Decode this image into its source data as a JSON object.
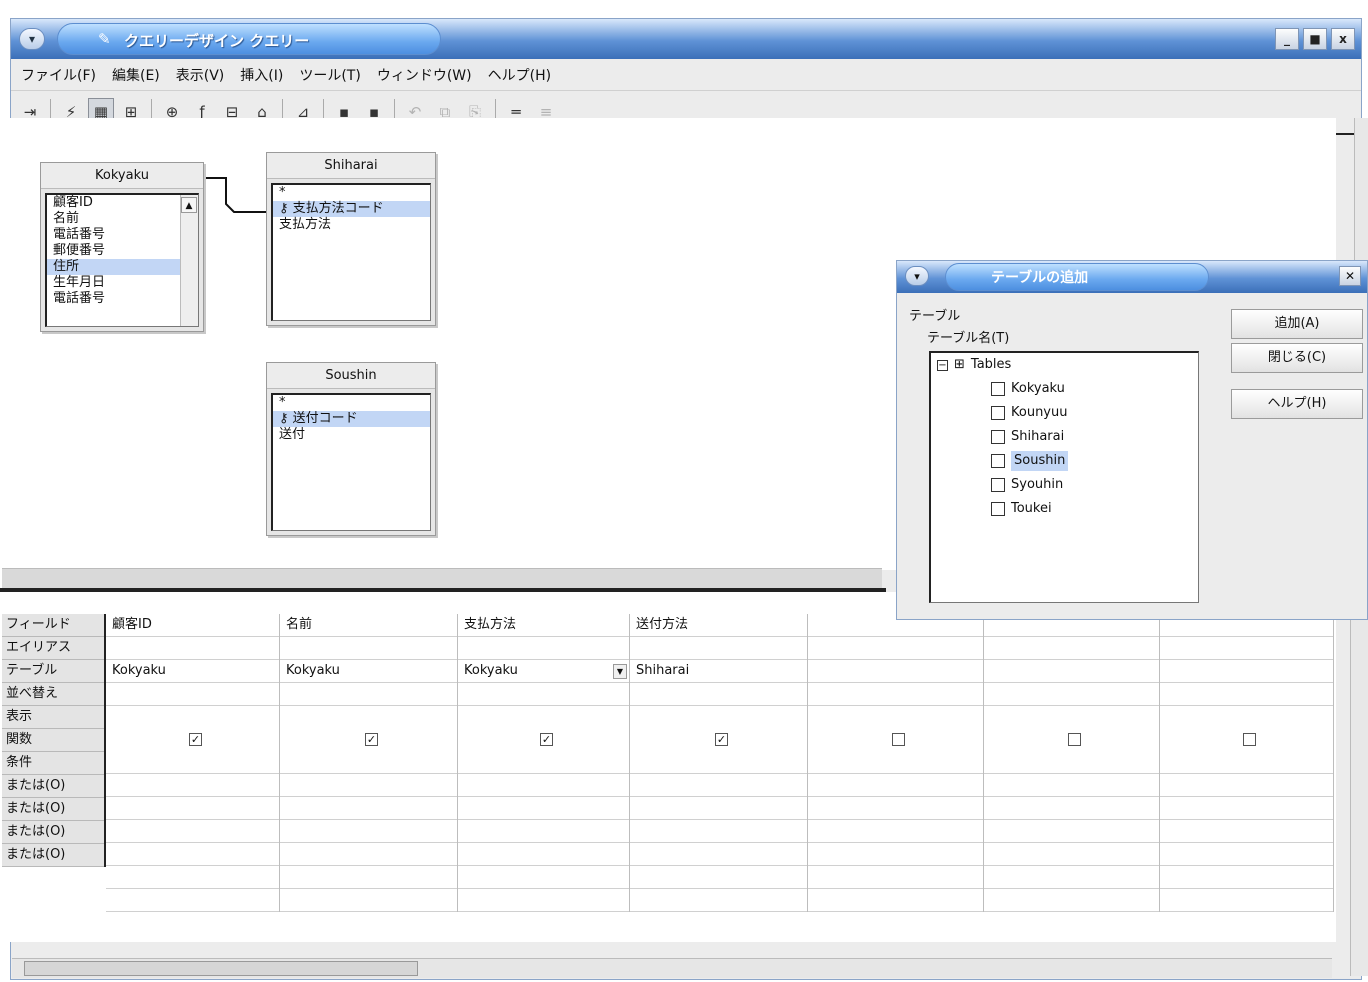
{
  "window": {
    "title": "クエリーデザイン クエリー",
    "controls": [
      "_",
      "■",
      "x"
    ]
  },
  "menu": [
    "ファイル(F)",
    "編集(E)",
    "表示(V)",
    "挿入(I)",
    "ツール(T)",
    "ウィンドウ(W)",
    "ヘルプ(H)"
  ],
  "design": {
    "tables": [
      {
        "name": "Kokyaku",
        "fields": [
          "顧客ID",
          "名前",
          "電話番号",
          "郵便番号",
          "住所",
          "生年月日",
          "電話番号"
        ],
        "selected": 4
      },
      {
        "name": "Shiharai",
        "fields": [
          "*",
          "支払方法コード",
          "支払方法"
        ],
        "selected": 1
      },
      {
        "name": "Soushin",
        "fields": [
          "*",
          "送付コード",
          "送付"
        ],
        "selected": 1
      }
    ]
  },
  "grid": {
    "row_labels": [
      "フィールド",
      "エイリアス",
      "テーブル",
      "並べ替え",
      "表示",
      "関数",
      "条件",
      "または(O)",
      "または(O)",
      "または(O)",
      "または(O)"
    ],
    "columns": [
      {
        "field": "顧客ID",
        "table": "Kokyaku",
        "show": true
      },
      {
        "field": "名前",
        "table": "Kokyaku",
        "show": true
      },
      {
        "field": "支払方法",
        "table": "Kokyaku",
        "show": true
      },
      {
        "field": "送付方法",
        "table": "Shiharai",
        "show": true
      },
      {
        "field": "",
        "table": "",
        "show": false
      },
      {
        "field": "",
        "table": "",
        "show": false
      },
      {
        "field": "",
        "table": "",
        "show": false
      }
    ]
  },
  "dialog": {
    "title": "テーブルの追加",
    "group_label": "テーブル",
    "list_label": "テーブル名(T)",
    "root": "Tables",
    "tables": [
      "Kokyaku",
      "Kounyuu",
      "Shiharai",
      "Soushin",
      "Syouhin",
      "Toukei"
    ],
    "selected": 3,
    "buttons": [
      "追加(A)",
      "閉じる(C)",
      "ヘルプ(H)"
    ]
  }
}
